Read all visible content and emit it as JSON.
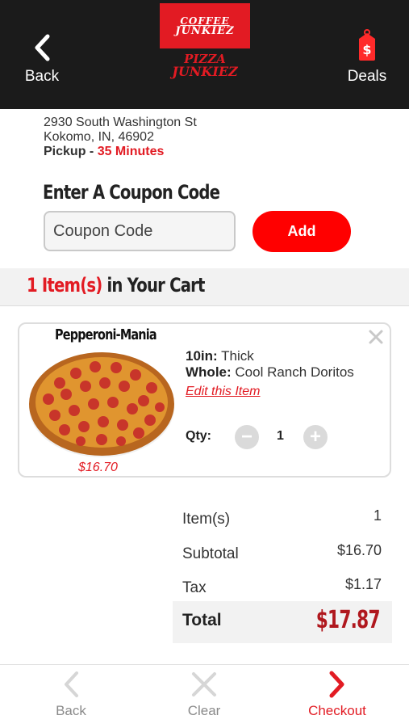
{
  "header": {
    "back_label": "Back",
    "deals_label": "Deals"
  },
  "logos": {
    "coffee_l1": "COFFEE",
    "coffee_l2": "JUNKIEZ",
    "pizza_l1": "PIZZA",
    "pizza_l2": "JUNKIEZ"
  },
  "store": {
    "address_line1": "2930 South Washington St",
    "address_line2": "Kokomo, IN, 46902",
    "pickup_label": "Pickup -",
    "pickup_time": "35 Minutes"
  },
  "coupon": {
    "title": "Enter A Coupon Code",
    "placeholder": "Coupon Code",
    "add_label": "Add"
  },
  "cart": {
    "count": "1 Item(s)",
    "title_rest": " in Your Cart"
  },
  "item": {
    "name": "Pepperoni-Mania",
    "price": "$16.70",
    "size_label": "10in:",
    "size_value": "Thick",
    "topping_label": "Whole:",
    "topping_value": "Cool Ranch Doritos",
    "edit_label": "Edit this Item",
    "qty_label": "Qty:",
    "qty_value": "1"
  },
  "summary": {
    "items_label": "Item(s)",
    "items_value": "1",
    "subtotal_label": "Subtotal",
    "subtotal_value": "$16.70",
    "tax_label": "Tax",
    "tax_value": "$1.17",
    "total_label": "Total",
    "total_value": "$17.87"
  },
  "footer": {
    "back_label": "Back",
    "clear_label": "Clear",
    "checkout_label": "Checkout"
  },
  "colors": {
    "brand_red": "#e21b23",
    "header_bg": "#1b1b1b",
    "total_red": "#b0181e"
  }
}
